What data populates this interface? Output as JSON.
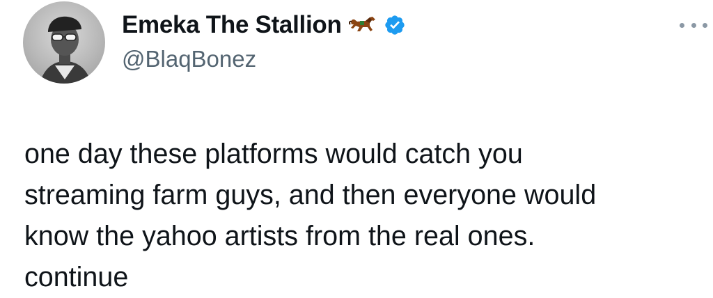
{
  "author": {
    "display_name": "Emeka The Stallion",
    "handle": "@BlaqBonez",
    "name_emoji_icon": "horse-icon",
    "verified_icon": "verified-badge-icon",
    "verified_color": "#1d9bf0"
  },
  "tweet": {
    "text": "one day these platforms would catch you\nstreaming farm guys, and then everyone would\nknow the yahoo artists from the real ones.\ncontinue"
  },
  "actions": {
    "more_icon": "more-options-icon"
  }
}
